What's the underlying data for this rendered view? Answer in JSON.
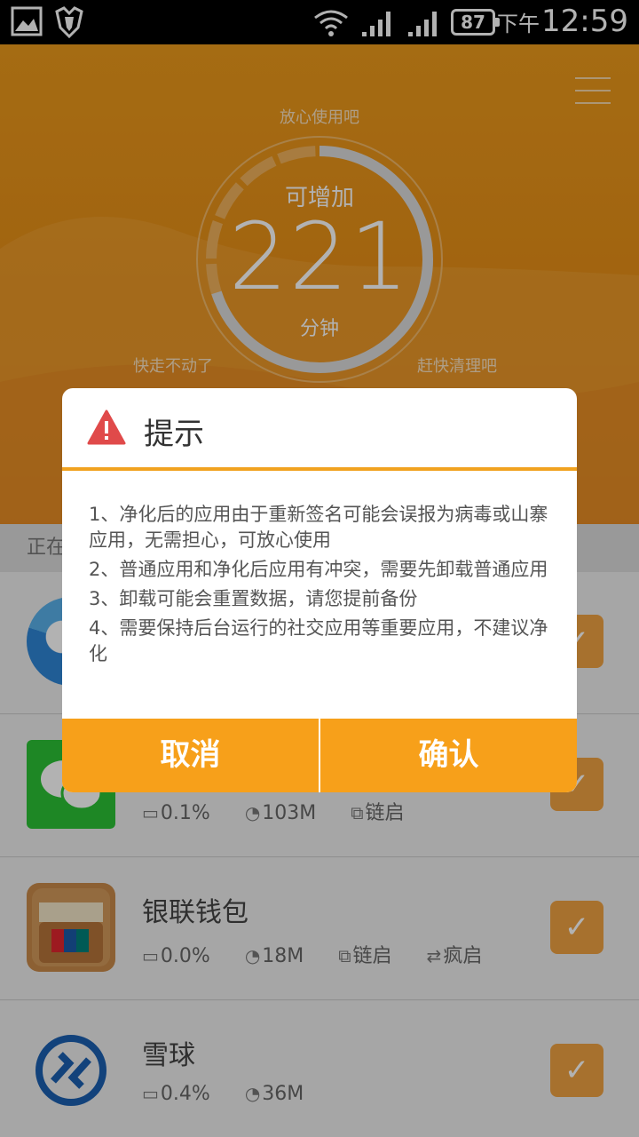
{
  "status_bar": {
    "battery": "87",
    "ampm": "下午",
    "time": "12:59"
  },
  "header": {
    "label_top": "放心使用吧",
    "label_left": "快走不动了",
    "label_right": "赶快清理吧",
    "center_title": "可增加",
    "center_value": "221",
    "center_unit": "分钟",
    "gauge_fill_fraction": 0.7
  },
  "list": {
    "header_text": "正在",
    "apps": [
      {
        "name": "",
        "battery": "",
        "storage": "",
        "autostart": "",
        "checked": true,
        "icon": "app-icon-colorful"
      },
      {
        "name": "",
        "battery": "0.1%",
        "storage": "103M",
        "autostart": "链启",
        "checked": true,
        "icon": "wechat-icon"
      },
      {
        "name": "银联钱包",
        "battery": "0.0%",
        "storage": "18M",
        "autostart": "链启",
        "crazystart": "疯启",
        "checked": true,
        "icon": "unionpay-wallet-icon"
      },
      {
        "name": "雪球",
        "battery": "0.4%",
        "storage": "36M",
        "checked": true,
        "icon": "xueqiu-icon"
      }
    ]
  },
  "dialog": {
    "title": "提示",
    "lines": [
      "1、净化后的应用由于重新签名可能会误报为病毒或山寨应用，无需担心，可放心使用",
      "2、普通应用和净化后应用有冲突，需要先卸载普通应用",
      "3、卸载可能会重置数据，请您提前备份",
      "4、需要保持后台运行的社交应用等重要应用，不建议净化"
    ],
    "cancel_label": "取消",
    "confirm_label": "确认"
  },
  "colors": {
    "accent": "#f7a01a",
    "warning": "#e04a4a",
    "header_orange": "#e88e17"
  }
}
